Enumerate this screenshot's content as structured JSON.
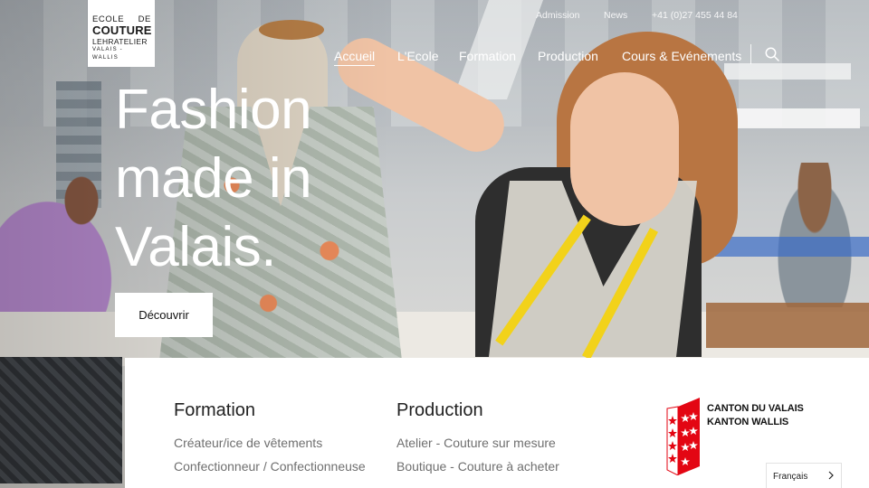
{
  "logo": {
    "line1_left": "ECOLE",
    "line1_right": "DE",
    "line2": "COUTURE",
    "line3": "LEHRATELIER",
    "line4": "VALAIS - WALLIS"
  },
  "utility_nav": {
    "admission": "Admission",
    "news": "News",
    "phone": "+41 (0)27 455 44 84"
  },
  "main_nav": {
    "items": [
      "Accueil",
      "L'Ecole",
      "Formation",
      "Production",
      "Cours & Evénements"
    ],
    "active": "Accueil"
  },
  "hero": {
    "headline": [
      "Fashion",
      "made in",
      "Valais."
    ],
    "cta_label": "Découvrir"
  },
  "footer_panel": {
    "formation": {
      "title": "Formation",
      "links": [
        "Créateur/ice de vêtements",
        "Confectionneur / Confectionneuse"
      ]
    },
    "production": {
      "title": "Production",
      "links": [
        "Atelier - Couture sur mesure",
        "Boutique - Couture à acheter"
      ]
    },
    "canton": {
      "line1": "CANTON DU VALAIS",
      "line2": "KANTON WALLIS"
    }
  },
  "language_selector": {
    "value": "Français"
  },
  "icons": {
    "search": "search-icon",
    "chevron": "chevron-right-icon",
    "crest": "valais-crest-icon"
  },
  "colors": {
    "crest_red": "#e30613",
    "nav_text": "#ffffff"
  }
}
